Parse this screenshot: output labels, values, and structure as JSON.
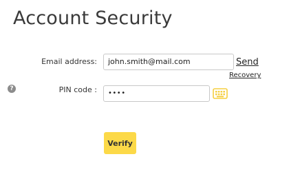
{
  "page": {
    "title": "Account Security"
  },
  "form": {
    "email_label": "Email address:",
    "email_value": "john.smith@mail.com",
    "send_label": "Send",
    "recovery_label": "Recovery",
    "pin_label": "PIN code :",
    "pin_value": "••••",
    "help_icon": "question-circle-icon",
    "keyboard_icon": "keyboard-icon"
  },
  "actions": {
    "verify_label": "Verify"
  },
  "colors": {
    "verify_button_bg": "#fcd948",
    "keyboard_icon": "#f5cf3f",
    "help_icon": "#8c8c8c"
  }
}
